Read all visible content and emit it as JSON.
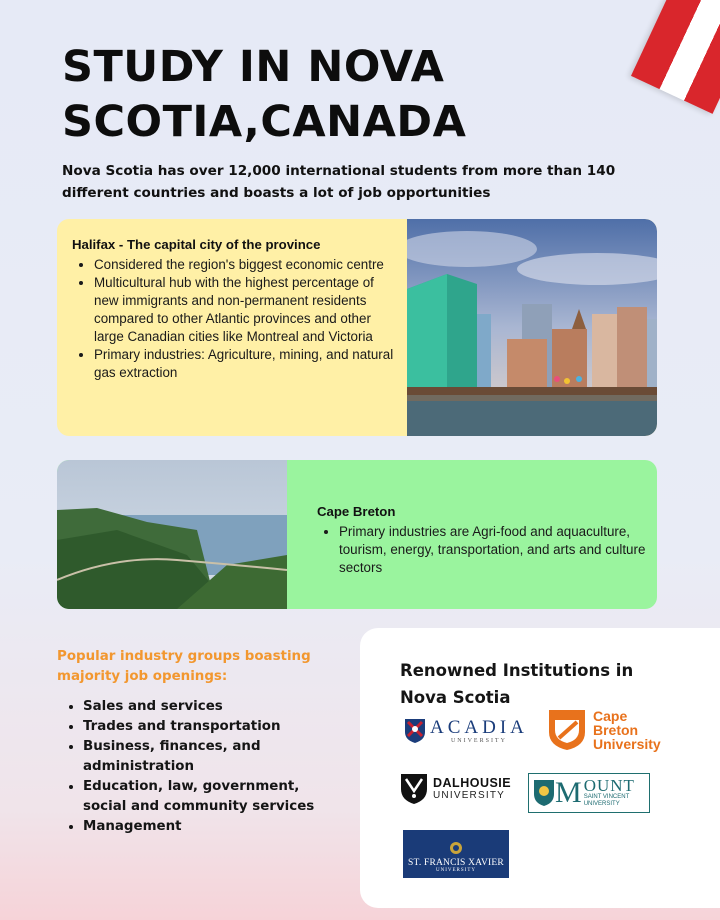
{
  "header": {
    "title": "STUDY IN NOVA SCOTIA,CANADA",
    "subtitle": "Nova Scotia has over 12,000 international students from more than 140 different countries and  boasts a lot of job opportunities"
  },
  "halifax": {
    "heading": "Halifax - The capital city of the province",
    "points": [
      "Considered the region's biggest economic centre",
      "Multicultural hub with the highest percentage of new immigrants and non-permanent residents compared to other Atlantic provinces and other large Canadian cities like Montreal and Victoria",
      "Primary industries: Agriculture, mining, and natural gas extraction"
    ]
  },
  "cape_breton": {
    "heading": "Cape Breton",
    "points": [
      "Primary industries are Agri-food and aquaculture, tourism, energy, transportation, and arts and culture sectors"
    ]
  },
  "industries": {
    "heading": "Popular industry groups boasting majority job openings:",
    "items": [
      "Sales and services",
      "Trades and transportation",
      "Business, finances, and administration",
      "Education, law, government, social and community services",
      "Management"
    ]
  },
  "institutions": {
    "heading": "Renowned Institutions in Nova Scotia",
    "acadia": {
      "name": "ACADIA",
      "sub": "UNIVERSITY"
    },
    "cbu": {
      "line1": "Cape",
      "line2": "Breton",
      "line3": "University"
    },
    "dalhousie": {
      "name": "DALHOUSIE",
      "sub": "UNIVERSITY"
    },
    "msvu": {
      "m": "M",
      "ount": "OUNT",
      "line1": "SAINT VINCENT",
      "line2": "UNIVERSITY"
    },
    "stfx": {
      "name": "ST. FRANCIS XAVIER",
      "sub": "UNIVERSITY"
    }
  },
  "colors": {
    "halifax_card": "#fff0a6",
    "cape_card": "#9af49e",
    "industry_heading": "#f2972f",
    "cbu_orange": "#e8721c",
    "stfx_blue": "#1a3b78"
  }
}
